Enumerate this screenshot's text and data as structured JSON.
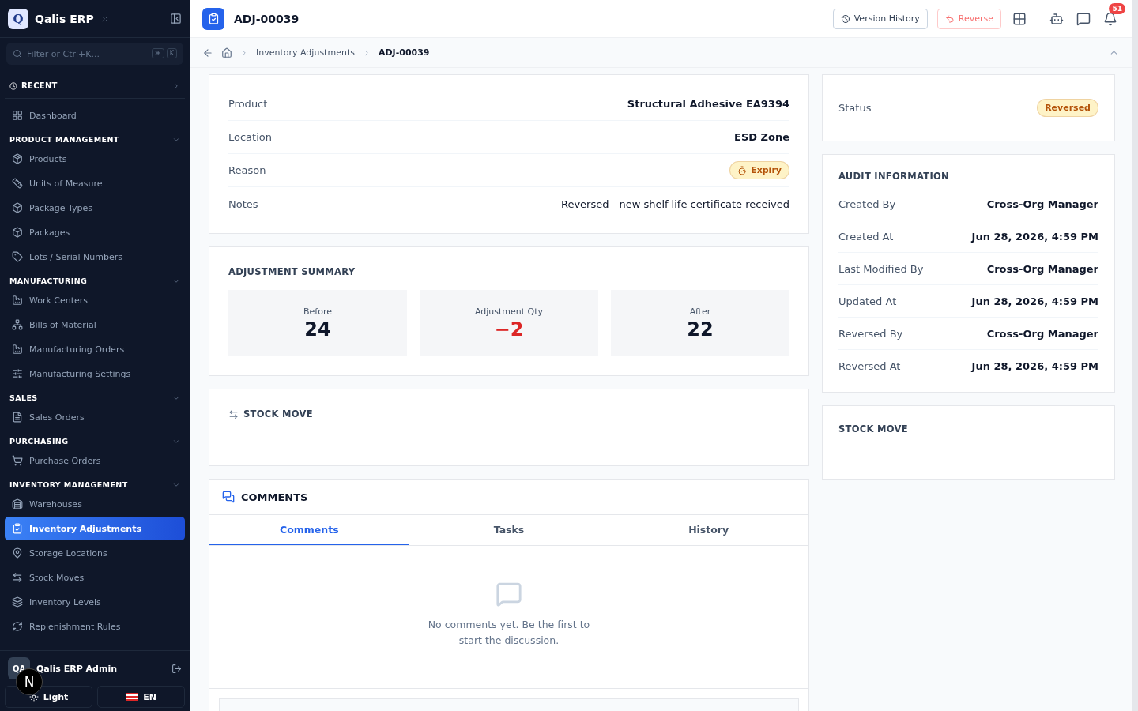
{
  "app": {
    "logo_letter": "Q",
    "name": "Qalis ERP"
  },
  "sidebar": {
    "search_placeholder": "Filter or Ctrl+K...",
    "shortcut_keys": [
      "⌘",
      "K"
    ],
    "recent": "RECENT",
    "sections": [
      {
        "items": [
          {
            "label": "Dashboard",
            "selected": false
          }
        ]
      },
      {
        "title": "PRODUCT MANAGEMENT",
        "expanded": true,
        "items": [
          {
            "label": "Products",
            "selected": false
          },
          {
            "label": "Units of Measure",
            "selected": false
          },
          {
            "label": "Package Types",
            "selected": false
          },
          {
            "label": "Packages",
            "selected": false
          },
          {
            "label": "Lots / Serial Numbers",
            "selected": false
          }
        ]
      },
      {
        "title": "MANUFACTURING",
        "expanded": true,
        "items": [
          {
            "label": "Work Centers",
            "selected": false
          },
          {
            "label": "Bills of Material",
            "selected": false
          },
          {
            "label": "Manufacturing Orders",
            "selected": false
          },
          {
            "label": "Manufacturing Settings",
            "selected": false
          }
        ]
      },
      {
        "title": "SALES",
        "expanded": true,
        "items": [
          {
            "label": "Sales Orders",
            "selected": false
          }
        ]
      },
      {
        "title": "PURCHASING",
        "expanded": true,
        "items": [
          {
            "label": "Purchase Orders",
            "selected": false
          }
        ]
      },
      {
        "title": "INVENTORY MANAGEMENT",
        "expanded": true,
        "items": [
          {
            "label": "Warehouses",
            "selected": false
          },
          {
            "label": "Inventory Adjustments",
            "selected": true
          },
          {
            "label": "Storage Locations",
            "selected": false
          },
          {
            "label": "Stock Moves",
            "selected": false
          },
          {
            "label": "Inventory Levels",
            "selected": false
          },
          {
            "label": "Replenishment Rules",
            "selected": false
          }
        ]
      }
    ],
    "user": {
      "initials": "QA",
      "name": "Qalis ERP Admin"
    },
    "dev_badge": "N",
    "theme_button": "Light",
    "language_button": "EN"
  },
  "topbar": {
    "title": "ADJ-00039",
    "buttons": [
      "Version History",
      "Reverse"
    ],
    "notification_count": "51"
  },
  "breadcrumb": [
    "Inventory Adjustments",
    "ADJ-00039"
  ],
  "details": [
    {
      "label": "Product",
      "value": "Structural Adhesive EA9394",
      "kind": "text"
    },
    {
      "label": "Location",
      "value": "ESD Zone",
      "kind": "text"
    },
    {
      "label": "Reason",
      "value": "Expiry",
      "kind": "badge"
    },
    {
      "label": "Notes",
      "value": "Reversed - new shelf-life certificate received",
      "kind": "note"
    }
  ],
  "status": {
    "label": "Status",
    "value": "Reversed"
  },
  "summary": {
    "title": "ADJUSTMENT SUMMARY",
    "items": [
      {
        "label": "Before",
        "value": "24",
        "kind": "neutral"
      },
      {
        "label": "Adjustment Qty",
        "value": "−2",
        "kind": "negative"
      },
      {
        "label": "After",
        "value": "22",
        "kind": "neutral"
      }
    ]
  },
  "stock_move": {
    "title": "STOCK MOVE"
  },
  "audit": {
    "title": "AUDIT INFORMATION",
    "rows": [
      {
        "label": "Created By",
        "value": "Cross-Org Manager"
      },
      {
        "label": "Created At",
        "value": "Jun 28, 2026, 4:59 PM"
      },
      {
        "label": "Last Modified By",
        "value": "Cross-Org Manager"
      },
      {
        "label": "Updated At",
        "value": "Jun 28, 2026, 4:59 PM"
      },
      {
        "label": "Reversed By",
        "value": "Cross-Org Manager"
      },
      {
        "label": "Reversed At",
        "value": "Jun 28, 2026, 4:59 PM"
      }
    ]
  },
  "side_stock_move": {
    "title": "STOCK MOVE"
  },
  "comments": {
    "title": "COMMENTS",
    "tabs": [
      {
        "label": "Comments",
        "selected": true
      },
      {
        "label": "Tasks",
        "selected": false
      },
      {
        "label": "History",
        "selected": false
      }
    ],
    "empty_text": "No comments yet. Be the first to start the discussion."
  }
}
